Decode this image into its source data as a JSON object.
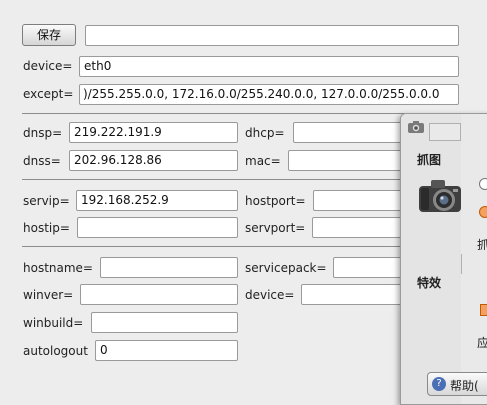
{
  "toolbar": {
    "save_label": "保存",
    "command_value": ""
  },
  "net": {
    "device_label": "device=",
    "device_value": "eth0",
    "except_label": "except=",
    "except_value": ")/255.255.0.0, 172.16.0.0/255.240.0.0, 127.0.0.0/255.0.0.0"
  },
  "dns": {
    "dnsp_label": "dnsp=",
    "dnsp_value": "219.222.191.9",
    "dhcp_label": "dhcp=",
    "dhcp_value": "",
    "dnss_label": "dnss=",
    "dnss_value": "202.96.128.86",
    "mac_label": "mac=",
    "mac_value": ""
  },
  "server": {
    "servip_label": "servip=",
    "servip_value": "192.168.252.9",
    "hostport_label": "hostport=",
    "hostport_value": "",
    "hostip_label": "hostip=",
    "hostip_value": "",
    "servport_label": "servport=",
    "servport_value": ""
  },
  "host": {
    "hostname_label": "hostname=",
    "hostname_value": "",
    "servicepack_label": "servicepack=",
    "servicepack_value": "",
    "winver_label": "winver=",
    "winver_value": "",
    "device_label": "device=",
    "device_value": "",
    "winbuild_label": "winbuild=",
    "winbuild_value": "",
    "autologout_label": "autologout",
    "autologout_value": "0"
  },
  "dialog": {
    "section_capture": "抓图",
    "section_effects": "特效",
    "partial_label_1": "抓",
    "partial_label_2": "应",
    "help_button": "帮助(",
    "icons": [
      "camera-icon",
      "camera-large-icon",
      "help-icon"
    ]
  }
}
